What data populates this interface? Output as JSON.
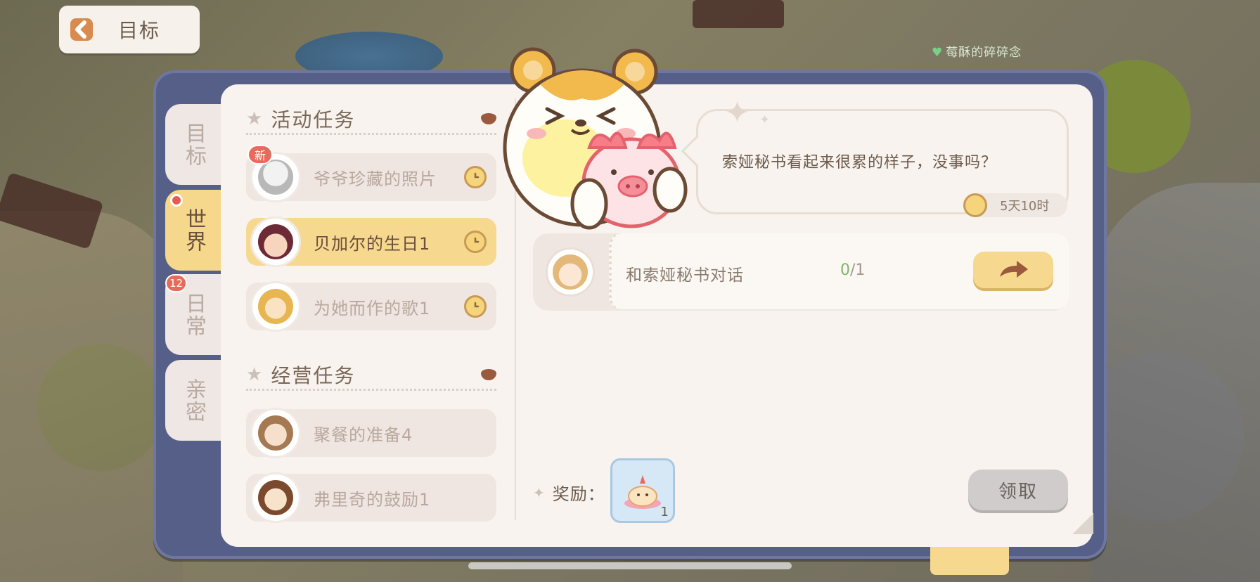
{
  "background": {
    "label": "莓酥的碎碎念"
  },
  "header": {
    "back_title": "目标"
  },
  "side_tabs": [
    {
      "label": "目标",
      "active": false
    },
    {
      "label": "世界",
      "active": true,
      "dot": true
    },
    {
      "label": "日常",
      "active": false,
      "count": "12"
    },
    {
      "label": "亲密",
      "active": false
    }
  ],
  "sections": {
    "event": {
      "title": "活动任务",
      "tasks": [
        {
          "name": "爷爷珍藏的照片",
          "badge": "新",
          "active": false
        },
        {
          "name": "贝加尔的生日1",
          "active": true
        },
        {
          "name": "为她而作的歌1",
          "active": false
        }
      ]
    },
    "business": {
      "title": "经营任务",
      "tasks": [
        {
          "name": "聚餐的准备4",
          "active": false
        },
        {
          "name": "弗里奇的鼓励1",
          "active": false
        }
      ]
    }
  },
  "detail": {
    "dialog": "索娅秘书看起来很累的样子，没事吗？",
    "time_left": "5天10时",
    "objective": {
      "text": "和索娅秘书对话",
      "current": "0",
      "total": "/1"
    },
    "reward_label": "奖励：",
    "reward_qty": "1",
    "claim_label": "领取"
  },
  "colors": {
    "frame": "#565f88",
    "panel": "#f8f3ee",
    "active_tab": "#f6d88c",
    "accent_red": "#e86a5d"
  }
}
